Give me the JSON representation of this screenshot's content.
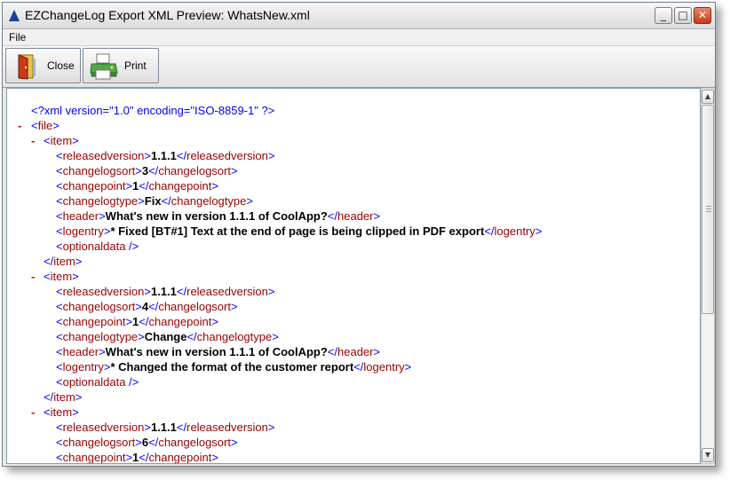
{
  "window": {
    "title": "EZChangeLog Export XML Preview:  WhatsNew.xml"
  },
  "title_buttons": {
    "minimize": "_",
    "maximize": "□",
    "close": "✕"
  },
  "menu": {
    "file": "File"
  },
  "toolbar": {
    "close_label": "Close",
    "print_label": "Print"
  },
  "xml": {
    "declaration": "<?xml version=\"1.0\" encoding=\"ISO-8859-1\" ?>",
    "collapse_marker": "-",
    "root_tag": "file",
    "items": [
      {
        "tag": "item",
        "fields": [
          {
            "tag": "releasedversion",
            "value": "1.1.1"
          },
          {
            "tag": "changelogsort",
            "value": "3"
          },
          {
            "tag": "changepoint",
            "value": "1"
          },
          {
            "tag": "changelogtype",
            "value": "Fix"
          },
          {
            "tag": "header",
            "value": "What's new in version 1.1.1 of CoolApp?"
          },
          {
            "tag": "logentry",
            "value": "* Fixed [BT#1] Text at the end of page is being clipped in PDF export"
          },
          {
            "tag": "optionaldata",
            "value": null
          }
        ]
      },
      {
        "tag": "item",
        "fields": [
          {
            "tag": "releasedversion",
            "value": "1.1.1"
          },
          {
            "tag": "changelogsort",
            "value": "4"
          },
          {
            "tag": "changepoint",
            "value": "1"
          },
          {
            "tag": "changelogtype",
            "value": "Change"
          },
          {
            "tag": "header",
            "value": "What's new in version 1.1.1 of CoolApp?"
          },
          {
            "tag": "logentry",
            "value": "* Changed the format of the customer report"
          },
          {
            "tag": "optionaldata",
            "value": null
          }
        ]
      },
      {
        "tag": "item",
        "fields": [
          {
            "tag": "releasedversion",
            "value": "1.1.1"
          },
          {
            "tag": "changelogsort",
            "value": "6"
          },
          {
            "tag": "changepoint",
            "value": "1"
          }
        ],
        "truncated": true
      }
    ]
  },
  "colors": {
    "bracket": "#0000ff",
    "tag_name": "#990000",
    "value": "#000000",
    "minus": "#d00000"
  }
}
